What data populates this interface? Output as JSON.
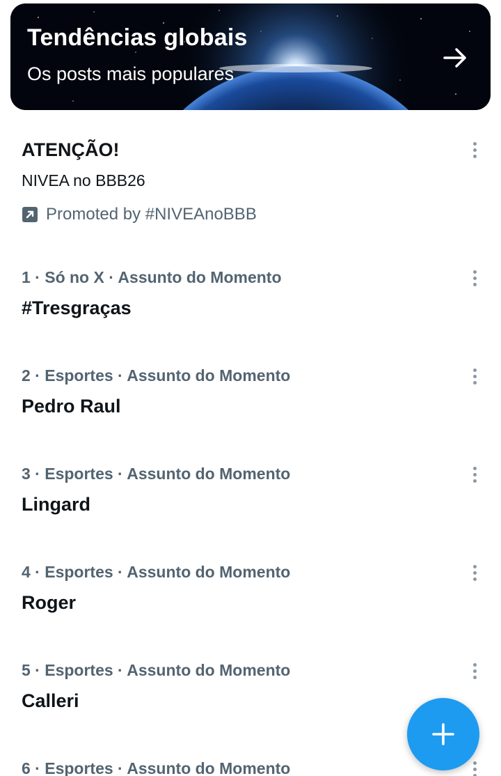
{
  "banner": {
    "title": "Tendências globais",
    "subtitle": "Os posts mais populares",
    "arrow_icon": "arrow-right-icon"
  },
  "promoted": {
    "title": "ATENÇÃO!",
    "description": "NIVEA no BBB26",
    "promoted_by": "Promoted by #NIVEAnoBBB",
    "icon": "promoted-arrow-icon"
  },
  "trends": [
    {
      "meta": "1 · Só no X · Assunto do Momento",
      "name": "#Tresgraças"
    },
    {
      "meta": "2 · Esportes · Assunto do Momento",
      "name": "Pedro Raul"
    },
    {
      "meta": "3 · Esportes · Assunto do Momento",
      "name": "Lingard"
    },
    {
      "meta": "4 · Esportes · Assunto do Momento",
      "name": "Roger"
    },
    {
      "meta": "5 · Esportes · Assunto do Momento",
      "name": "Calleri"
    },
    {
      "meta": "6 · Esportes · Assunto do Momento",
      "name": ""
    }
  ],
  "fab": {
    "icon": "plus-icon"
  },
  "colors": {
    "accent": "#1d9bf0",
    "secondary_text": "#536471",
    "primary_text": "#0f1419"
  }
}
